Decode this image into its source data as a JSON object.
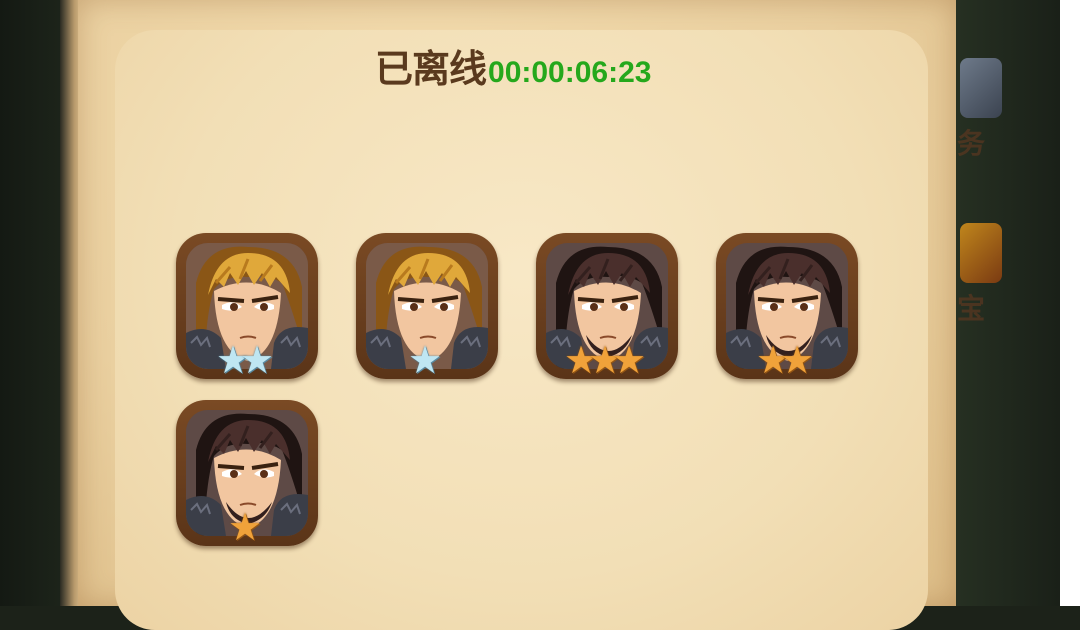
{
  "header": {
    "offline_label": "已离线",
    "offline_time": "00:00:06:23"
  },
  "side_menu": {
    "items": [
      {
        "label": "务"
      },
      {
        "label": "宝"
      }
    ]
  },
  "heroes": [
    {
      "name": "blonde-warrior",
      "hair": "blonde",
      "star_count": 2,
      "star_type": "silver"
    },
    {
      "name": "blonde-warrior",
      "hair": "blonde",
      "star_count": 1,
      "star_type": "silver"
    },
    {
      "name": "dark-haired-warrior",
      "hair": "dark",
      "star_count": 3,
      "star_type": "gold"
    },
    {
      "name": "dark-haired-warrior",
      "hair": "dark",
      "star_count": 2,
      "star_type": "gold"
    },
    {
      "name": "dark-haired-warrior",
      "hair": "dark",
      "star_count": 1,
      "star_type": "gold"
    }
  ],
  "colors": {
    "timer_green": "#25a81c",
    "label_brown": "#5a3a1e",
    "frame_brown": "#6b3e1e",
    "gold_star": "#f0a23a",
    "silver_star": "#bfe6f2"
  }
}
